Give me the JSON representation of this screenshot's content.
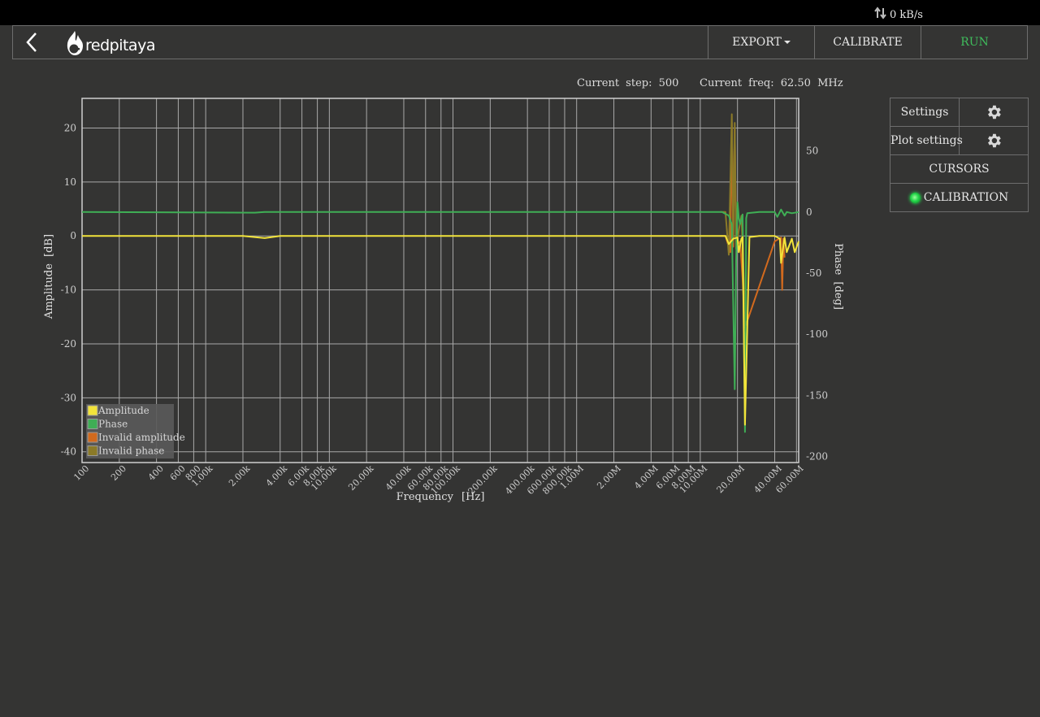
{
  "topbar": {
    "rate_text": "0 kB/s",
    "rate_icon": "transfer-arrows-icon"
  },
  "header": {
    "back_icon": "chevron-left-icon",
    "logo_text": "redpitaya",
    "logo_icon": "redpitaya-flame-icon",
    "export_label": "EXPORT",
    "calibrate_label": "CALIBRATE",
    "run_label": "RUN",
    "run_color": "#3fbd5c"
  },
  "status": {
    "step_label": "Current step:",
    "step_value": "500",
    "freq_label": "Current freq:",
    "freq_value": "62.50",
    "freq_unit": "MHz"
  },
  "side_panel": {
    "settings_label": "Settings",
    "plot_settings_label": "Plot settings",
    "cursors_label": "CURSORS",
    "calibration_label": "CALIBRATION",
    "calibration_led": "green",
    "gear_icon": "gear-icon"
  },
  "chart_data": {
    "type": "line",
    "xlabel": "Frequency [Hz]",
    "ylabel": "Amplitude [dB]",
    "y2label": "Phase [deg]",
    "x_scale": "log",
    "xlim": [
      100,
      62500000
    ],
    "ylim": [
      -42,
      25.5
    ],
    "y2lim": [
      -205,
      93
    ],
    "grid": true,
    "legend_position": "bottom-left",
    "x_ticks": [
      100,
      200,
      400,
      600,
      800,
      1000,
      2000,
      4000,
      6000,
      8000,
      10000,
      20000,
      40000,
      60000,
      80000,
      100000,
      200000,
      400000,
      600000,
      800000,
      1000000,
      2000000,
      4000000,
      6000000,
      8000000,
      10000000,
      20000000,
      40000000,
      60000000
    ],
    "x_tick_labels": [
      "100",
      "200",
      "400",
      "600",
      "800",
      "1.00k",
      "2.00k",
      "4.00k",
      "6.00k",
      "8.00k",
      "10.00k",
      "20.00k",
      "40.00k",
      "60.00k",
      "80.00k",
      "100.00k",
      "200.00k",
      "400.00k",
      "600.00k",
      "800.00k",
      "1.00M",
      "2.00M",
      "4.00M",
      "6.00M",
      "8.00M",
      "10.00M",
      "20.00M",
      "40.00M",
      "60.00M"
    ],
    "y_ticks": [
      20,
      10,
      0,
      -10,
      -20,
      -30,
      -40
    ],
    "y_tick_labels": [
      "20",
      "10",
      "0",
      "-10",
      "-20",
      "-30",
      "-40"
    ],
    "y2_ticks": [
      50,
      0,
      -50,
      -100,
      -150,
      -200
    ],
    "y2_tick_labels": [
      "50",
      "0",
      "-50",
      "-100",
      "-150",
      "-200"
    ],
    "series": [
      {
        "name": "Amplitude",
        "axis": "left",
        "color": "#f2e33a",
        "x": [
          100,
          2000,
          3000,
          4000,
          15000000,
          16000000,
          17000000,
          18500000,
          20000000,
          20500000,
          21500000,
          22000000,
          23000000,
          25000000,
          30000000,
          40000000,
          44000000,
          45000000,
          48000000,
          50000000,
          52000000,
          55000000,
          58000000,
          62500000
        ],
        "y": [
          0,
          0,
          -0.4,
          0,
          0,
          0,
          -1.5,
          -0.5,
          -0.3,
          -3,
          -0.5,
          -0.2,
          -35,
          -0.2,
          0,
          0,
          -0.5,
          -5,
          -0.3,
          -3,
          -2,
          -0.5,
          -3,
          -1
        ]
      },
      {
        "name": "Phase",
        "axis": "right",
        "color": "#3fae55",
        "x": [
          100,
          2500,
          3000,
          15000000,
          17000000,
          18000000,
          19000000,
          19500000,
          20000000,
          20500000,
          21000000,
          22000000,
          23000000,
          23500000,
          24000000,
          30000000,
          40000000,
          42000000,
          45000000,
          48000000,
          50000000,
          55000000,
          62500000
        ],
        "y": [
          0,
          -0.5,
          0,
          0,
          -3,
          -10,
          -145,
          -40,
          8,
          -5,
          -10,
          -2,
          -180,
          -5,
          -1,
          0,
          0,
          -4,
          2,
          -3,
          0,
          -1,
          0
        ]
      },
      {
        "name": "Invalid amplitude",
        "axis": "left",
        "color": "#d26a1e",
        "x": [
          14500000,
          16000000,
          17500000,
          18000000,
          18500000,
          19000000,
          19500000,
          21000000,
          22000000,
          23000000,
          40000000,
          45000000,
          46000000,
          47000000,
          48000000
        ],
        "y": [
          0,
          0,
          -3,
          21,
          -2,
          20,
          -2,
          -1,
          -8,
          -17,
          -1,
          -0.3,
          -10,
          -0.5,
          -4
        ]
      },
      {
        "name": "Invalid phase",
        "axis": "right",
        "color": "#8b7a28",
        "x": [
          14500000,
          16000000,
          17000000,
          18000000,
          18500000,
          19000000,
          19500000,
          20500000,
          21500000,
          23000000
        ],
        "y": [
          0,
          0,
          -35,
          80,
          -25,
          73,
          -30,
          -15,
          -3,
          -80
        ]
      }
    ]
  }
}
